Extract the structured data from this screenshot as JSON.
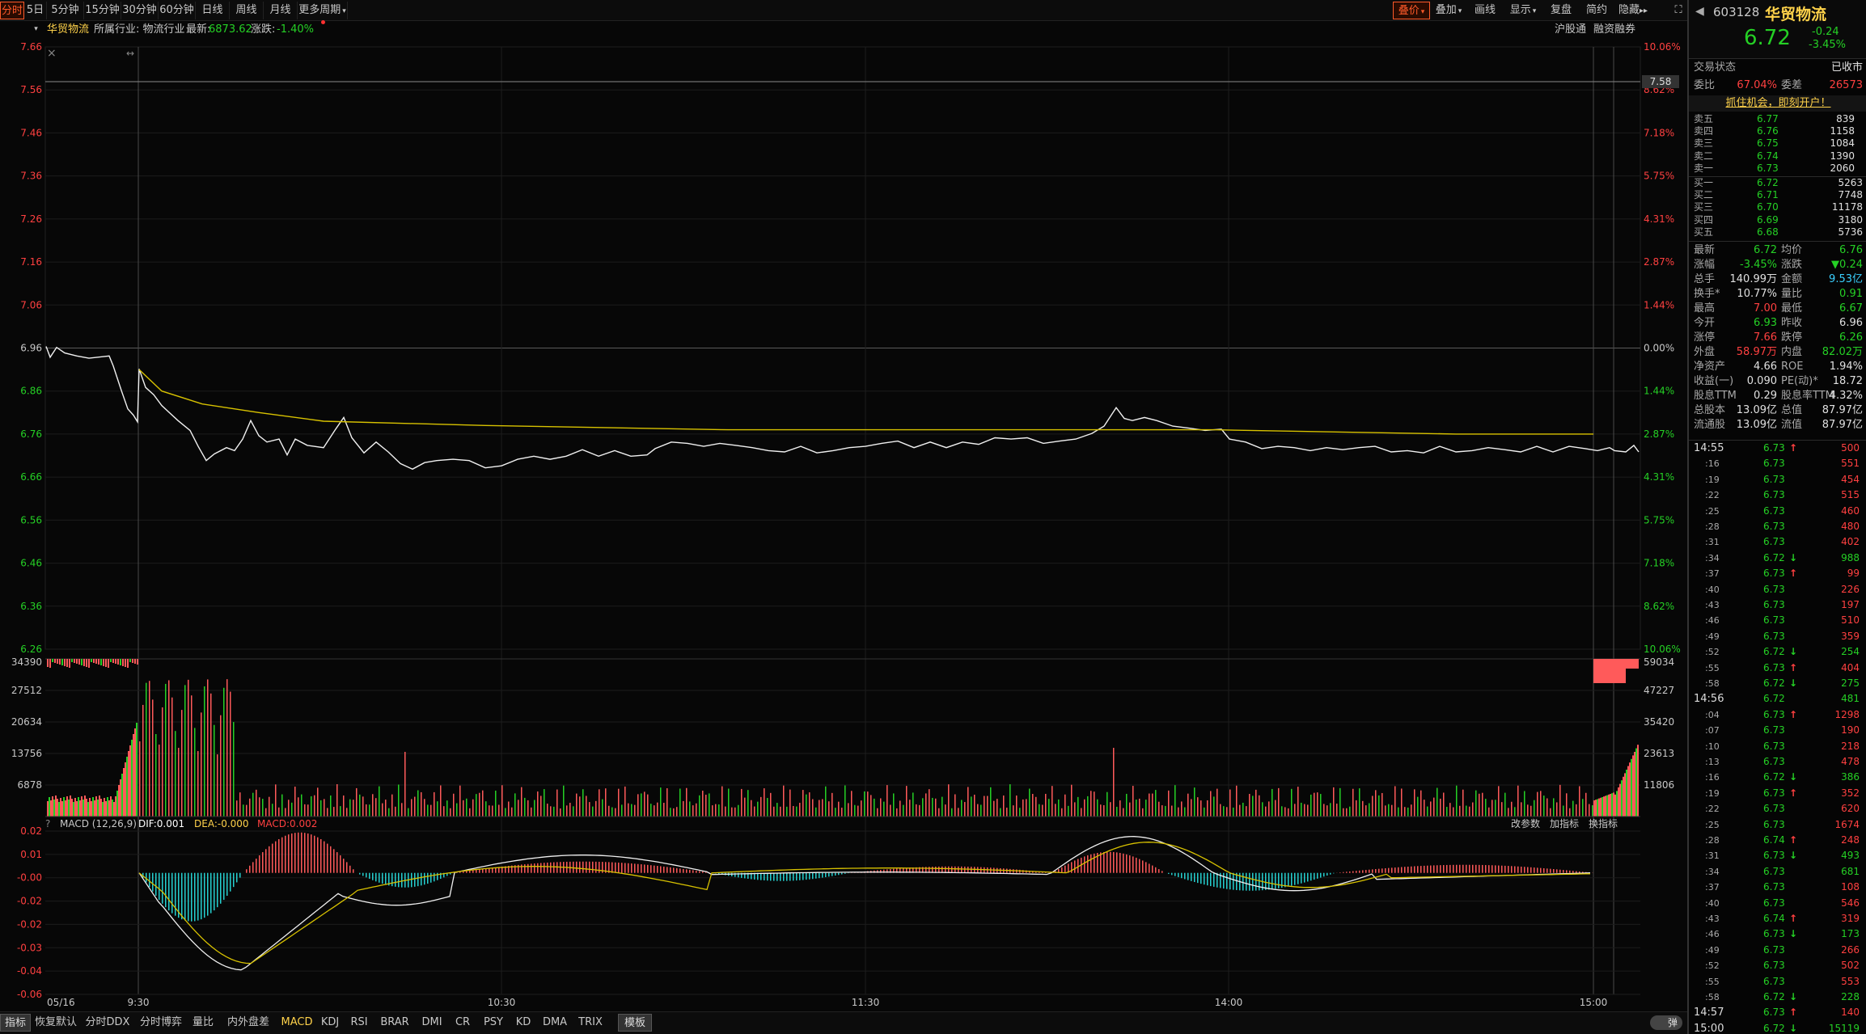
{
  "periods": [
    "分时",
    "5日",
    "5分钟",
    "15分钟",
    "30分钟",
    "60分钟",
    "日线",
    "周线",
    "月线",
    "更多周期"
  ],
  "right_tabs": [
    "叠价",
    "叠加",
    "画线",
    "显示",
    "复盘",
    "简约",
    "隐藏"
  ],
  "stock_bar": {
    "name": "华贸物流",
    "industry": "所属行业: 物流行业",
    "latest_label": "最新:",
    "latest": "6873.62",
    "chg_label": "涨跌:",
    "chg": "-1.40%",
    "tags": [
      "沪股通",
      "融资融券"
    ]
  },
  "chart": {
    "left_ticks": [
      "7.66",
      "7.56",
      "7.46",
      "7.36",
      "7.26",
      "7.16",
      "7.06",
      "6.96",
      "6.86",
      "6.76",
      "6.66",
      "6.56",
      "6.46",
      "6.36",
      "6.26"
    ],
    "right_ticks": [
      "10.06%",
      "8.62%",
      "7.18%",
      "5.75%",
      "4.31%",
      "2.87%",
      "1.44%",
      "0.00%",
      "1.44%",
      "2.87%",
      "4.31%",
      "5.75%",
      "7.18%",
      "8.62%",
      "10.06%"
    ],
    "vol_left": [
      "34390",
      "27512",
      "20634",
      "13756",
      "6878"
    ],
    "vol_right": [
      "59034",
      "47227",
      "35420",
      "23613",
      "11806"
    ],
    "macd_left": [
      "0.02",
      "0.01",
      "-0.00",
      "-0.02",
      "-0.02",
      "-0.03",
      "-0.04",
      "-0.06"
    ],
    "time_labels": [
      "05/16",
      "9:30",
      "10:30",
      "11:30",
      "14:00",
      "15:00"
    ],
    "price_tag": "7.58",
    "macd_title": "MACD (12,26,9)",
    "dif": "DIF:0.001",
    "dea": "DEA:-0.000",
    "macd": "MACD:0.002",
    "macd_actions": [
      "改参数",
      "加指标",
      "换指标"
    ]
  },
  "bottom_tabs": [
    "指标",
    "恢复默认",
    "分时DDX",
    "分时博弈",
    "量比",
    "内外盘差",
    "MACD",
    "KDJ",
    "RSI",
    "BRAR",
    "DMI",
    "CR",
    "PSY",
    "KD",
    "DMA",
    "TRIX",
    "模板"
  ],
  "toggle_label": "弹",
  "side": {
    "code": "603128",
    "name": "华贸物流",
    "price": "6.72",
    "chg": "-0.24",
    "pct": "-3.45%",
    "trade_state_label": "交易状态",
    "trade_state": "已收市",
    "wb_label": "委比",
    "wb": "67.04%",
    "wc_label": "委差",
    "wc": "26573",
    "promo": "抓住机会，即刻开户！",
    "asks": [
      {
        "l": "卖五",
        "p": "6.77",
        "v": "839"
      },
      {
        "l": "卖四",
        "p": "6.76",
        "v": "1158"
      },
      {
        "l": "卖三",
        "p": "6.75",
        "v": "1084"
      },
      {
        "l": "卖二",
        "p": "6.74",
        "v": "1390"
      },
      {
        "l": "卖一",
        "p": "6.73",
        "v": "2060"
      }
    ],
    "bids": [
      {
        "l": "买一",
        "p": "6.72",
        "v": "5263"
      },
      {
        "l": "买二",
        "p": "6.71",
        "v": "7748"
      },
      {
        "l": "买三",
        "p": "6.70",
        "v": "11178"
      },
      {
        "l": "买四",
        "p": "6.69",
        "v": "3180"
      },
      {
        "l": "买五",
        "p": "6.68",
        "v": "5736"
      }
    ],
    "stats": [
      {
        "l1": "最新",
        "v1": "6.72",
        "c1": "green",
        "l2": "均价",
        "v2": "6.76",
        "c2": "green"
      },
      {
        "l1": "涨幅",
        "v1": "-3.45%",
        "c1": "green",
        "l2": "涨跌",
        "v2": "▼0.24",
        "c2": "green"
      },
      {
        "l1": "总手",
        "v1": "140.99万",
        "c1": "white",
        "l2": "金额",
        "v2": "9.53亿",
        "c2": "cyan"
      },
      {
        "l1": "换手*",
        "v1": "10.77%",
        "c1": "white",
        "l2": "量比",
        "v2": "0.91",
        "c2": "green"
      },
      {
        "l1": "最高",
        "v1": "7.00",
        "c1": "red",
        "l2": "最低",
        "v2": "6.67",
        "c2": "green"
      },
      {
        "l1": "今开",
        "v1": "6.93",
        "c1": "green",
        "l2": "昨收",
        "v2": "6.96",
        "c2": "white"
      },
      {
        "l1": "涨停",
        "v1": "7.66",
        "c1": "red",
        "l2": "跌停",
        "v2": "6.26",
        "c2": "green"
      },
      {
        "l1": "外盘",
        "v1": "58.97万",
        "c1": "red",
        "l2": "内盘",
        "v2": "82.02万",
        "c2": "green"
      },
      {
        "l1": "净资产",
        "v1": "4.66",
        "c1": "white",
        "l2": "ROE",
        "v2": "1.94%",
        "c2": "white"
      },
      {
        "l1": "收益(一)",
        "v1": "0.090",
        "c1": "white",
        "l2": "PE(动)*",
        "v2": "18.72",
        "c2": "white"
      },
      {
        "l1": "股息TTM",
        "v1": "0.29",
        "c1": "white",
        "l2": "股息率TTM",
        "v2": "4.32%",
        "c2": "white"
      },
      {
        "l1": "总股本",
        "v1": "13.09亿",
        "c1": "white",
        "l2": "总值",
        "v2": "87.97亿",
        "c2": "white"
      },
      {
        "l1": "流通股",
        "v1": "13.09亿",
        "c1": "white",
        "l2": "流值",
        "v2": "87.97亿",
        "c2": "white"
      }
    ],
    "ticks": [
      {
        "t": "14:55",
        "p": "6.73",
        "a": "up",
        "v": "500",
        "c": "red"
      },
      {
        "t": ":16",
        "p": "6.73",
        "a": "",
        "v": "551",
        "c": "red"
      },
      {
        "t": ":19",
        "p": "6.73",
        "a": "",
        "v": "454",
        "c": "red"
      },
      {
        "t": ":22",
        "p": "6.73",
        "a": "",
        "v": "515",
        "c": "red"
      },
      {
        "t": ":25",
        "p": "6.73",
        "a": "",
        "v": "460",
        "c": "red"
      },
      {
        "t": ":28",
        "p": "6.73",
        "a": "",
        "v": "480",
        "c": "red"
      },
      {
        "t": ":31",
        "p": "6.73",
        "a": "",
        "v": "402",
        "c": "red"
      },
      {
        "t": ":34",
        "p": "6.72",
        "a": "down",
        "v": "988",
        "c": "green"
      },
      {
        "t": ":37",
        "p": "6.73",
        "a": "up",
        "v": "99",
        "c": "red"
      },
      {
        "t": ":40",
        "p": "6.73",
        "a": "",
        "v": "226",
        "c": "red"
      },
      {
        "t": ":43",
        "p": "6.73",
        "a": "",
        "v": "197",
        "c": "red"
      },
      {
        "t": ":46",
        "p": "6.73",
        "a": "",
        "v": "510",
        "c": "red"
      },
      {
        "t": ":49",
        "p": "6.73",
        "a": "",
        "v": "359",
        "c": "red"
      },
      {
        "t": ":52",
        "p": "6.72",
        "a": "down",
        "v": "254",
        "c": "green"
      },
      {
        "t": ":55",
        "p": "6.73",
        "a": "up",
        "v": "404",
        "c": "red"
      },
      {
        "t": ":58",
        "p": "6.72",
        "a": "down",
        "v": "275",
        "c": "green"
      },
      {
        "t": "14:56",
        "p": "6.72",
        "a": "",
        "v": "481",
        "c": "green"
      },
      {
        "t": ":04",
        "p": "6.73",
        "a": "up",
        "v": "1298",
        "c": "red"
      },
      {
        "t": ":07",
        "p": "6.73",
        "a": "",
        "v": "190",
        "c": "red"
      },
      {
        "t": ":10",
        "p": "6.73",
        "a": "",
        "v": "218",
        "c": "red"
      },
      {
        "t": ":13",
        "p": "6.73",
        "a": "",
        "v": "478",
        "c": "red"
      },
      {
        "t": ":16",
        "p": "6.72",
        "a": "down",
        "v": "386",
        "c": "green"
      },
      {
        "t": ":19",
        "p": "6.73",
        "a": "up",
        "v": "352",
        "c": "red"
      },
      {
        "t": ":22",
        "p": "6.73",
        "a": "",
        "v": "620",
        "c": "red"
      },
      {
        "t": ":25",
        "p": "6.73",
        "a": "",
        "v": "1674",
        "c": "red"
      },
      {
        "t": ":28",
        "p": "6.74",
        "a": "up",
        "v": "248",
        "c": "red"
      },
      {
        "t": ":31",
        "p": "6.73",
        "a": "down",
        "v": "493",
        "c": "green"
      },
      {
        "t": ":34",
        "p": "6.73",
        "a": "",
        "v": "681",
        "c": "green"
      },
      {
        "t": ":37",
        "p": "6.73",
        "a": "",
        "v": "108",
        "c": "red"
      },
      {
        "t": ":40",
        "p": "6.73",
        "a": "",
        "v": "546",
        "c": "red"
      },
      {
        "t": ":43",
        "p": "6.74",
        "a": "up",
        "v": "319",
        "c": "red"
      },
      {
        "t": ":46",
        "p": "6.73",
        "a": "down",
        "v": "173",
        "c": "green"
      },
      {
        "t": ":49",
        "p": "6.73",
        "a": "",
        "v": "266",
        "c": "red"
      },
      {
        "t": ":52",
        "p": "6.73",
        "a": "",
        "v": "502",
        "c": "red"
      },
      {
        "t": ":55",
        "p": "6.73",
        "a": "",
        "v": "553",
        "c": "red"
      },
      {
        "t": ":58",
        "p": "6.72",
        "a": "down",
        "v": "228",
        "c": "green"
      },
      {
        "t": "14:57",
        "p": "6.73",
        "a": "up",
        "v": "140",
        "c": "red"
      },
      {
        "t": "15:00",
        "p": "6.72",
        "a": "down",
        "v": "15119",
        "c": "green"
      }
    ]
  }
}
